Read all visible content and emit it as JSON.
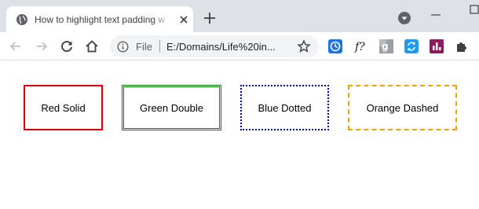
{
  "browser": {
    "tab": {
      "title": "How to highlight text padding w"
    },
    "omnibox": {
      "scheme_label": "File",
      "url": "E:/Domains/Life%20in..."
    },
    "icons": {
      "favicon": "globe-icon",
      "close": "close-icon",
      "new_tab": "plus-icon",
      "profile": "profile-dropdown-icon",
      "back": "arrow-left-icon",
      "forward": "arrow-right-icon",
      "reload": "reload-icon",
      "home": "home-icon",
      "info": "info-icon",
      "star": "star-icon"
    },
    "extensions": [
      {
        "name": "history-extension-icon",
        "color": "#1a73e8"
      },
      {
        "name": "function-extension-icon",
        "glyph": "f?"
      },
      {
        "name": "google-extension-icon",
        "glyph": "g"
      },
      {
        "name": "sync-extension-icon",
        "color": "#1e9bf0"
      },
      {
        "name": "analytics-extension-icon",
        "color": "#8e1b5e"
      },
      {
        "name": "puzzle-extensions-icon"
      }
    ]
  },
  "page": {
    "boxes": [
      {
        "label": "Red Solid",
        "border_color": "#dd0000",
        "border_style": "solid"
      },
      {
        "label": "Green Double",
        "border_color": "#008000",
        "border_style": "double"
      },
      {
        "label": "Blue Dotted",
        "border_color": "#0000bb",
        "border_style": "dotted"
      },
      {
        "label": "Orange Dashed",
        "border_color": "#f0a000",
        "border_style": "dashed"
      }
    ]
  }
}
